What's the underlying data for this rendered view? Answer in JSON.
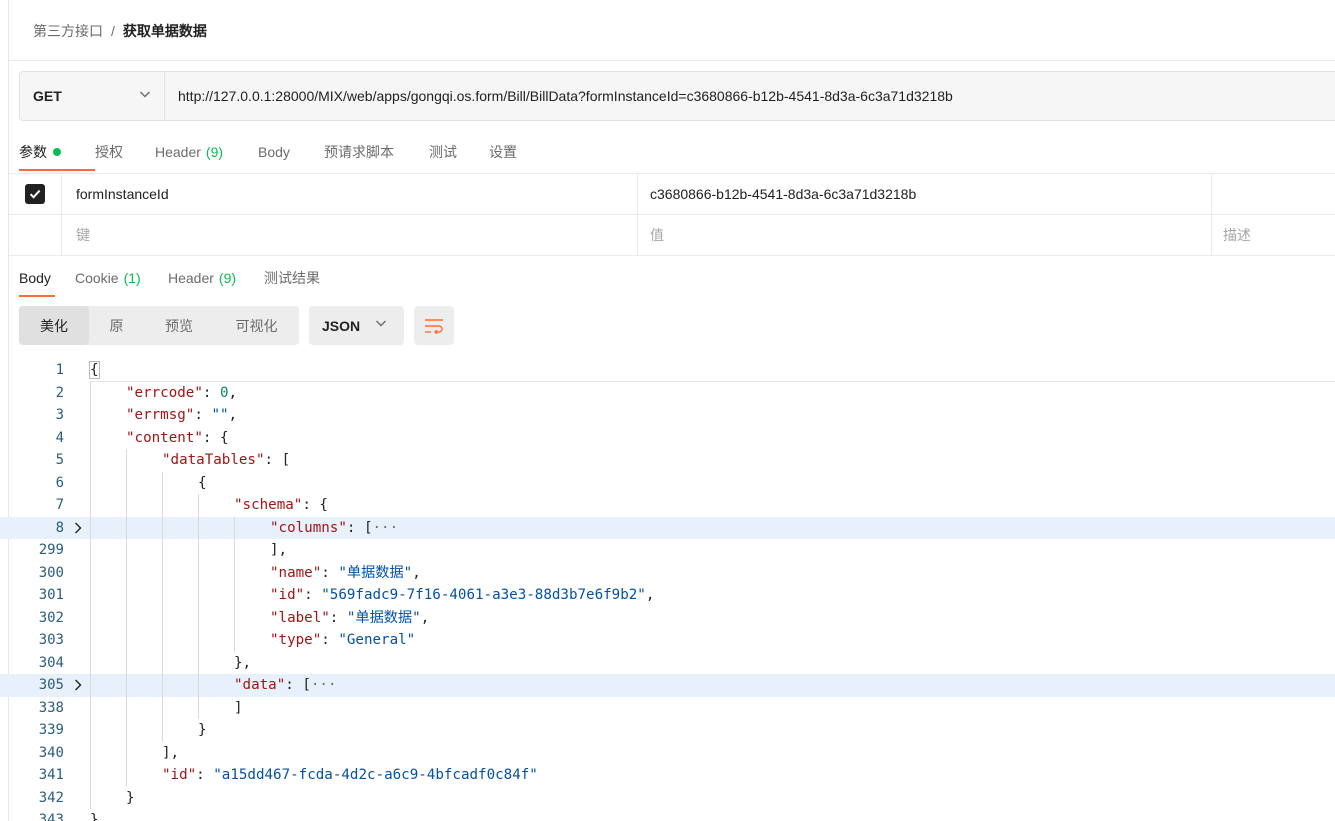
{
  "breadcrumb": {
    "parent": "第三方接口",
    "separator": "/",
    "current": "获取单据数据"
  },
  "request": {
    "method": "GET",
    "url": "http://127.0.0.1:28000/MIX/web/apps/gongqi.os.form/Bill/BillData?formInstanceId=c3680866-b12b-4541-8d3a-6c3a71d3218b"
  },
  "request_tabs": [
    {
      "label": "参数",
      "count": "",
      "dot": true,
      "active": true
    },
    {
      "label": "授权",
      "count": ""
    },
    {
      "label": "Header",
      "count": "(9)"
    },
    {
      "label": "Body",
      "count": ""
    },
    {
      "label": "预请求脚本",
      "count": ""
    },
    {
      "label": "测试",
      "count": ""
    },
    {
      "label": "设置",
      "count": ""
    }
  ],
  "params": {
    "rows": [
      {
        "checked": true,
        "key": "formInstanceId",
        "value": "c3680866-b12b-4541-8d3a-6c3a71d3218b",
        "description": ""
      }
    ],
    "placeholder": {
      "key": "键",
      "value": "值",
      "description": "描述"
    }
  },
  "response_tabs": [
    {
      "label": "Body",
      "count": "",
      "active": true
    },
    {
      "label": "Cookie",
      "count": "(1)"
    },
    {
      "label": "Header",
      "count": "(9)"
    },
    {
      "label": "测试结果",
      "count": ""
    }
  ],
  "view_modes": [
    "美化",
    "原",
    "预览",
    "可视化"
  ],
  "view_mode_active": "美化",
  "format": "JSON",
  "icons": {
    "method_dropdown": "chevron-down-icon",
    "format_dropdown": "chevron-down-icon",
    "wrap": "text-wrap-icon",
    "fold": "chevron-right-icon",
    "checkbox": "checkmark-icon"
  },
  "colors": {
    "accent": "#ff6c37",
    "status_green": "#0cbb52",
    "json_key": "#a31515",
    "json_string": "#0451a5",
    "json_number": "#098658",
    "highlight_row": "#e8f1fb"
  },
  "code_lines": [
    {
      "n": "1",
      "indent": 0,
      "parts": [
        [
          "p",
          "{"
        ]
      ],
      "caret": true
    },
    {
      "n": "2",
      "indent": 1,
      "parts": [
        [
          "k",
          "\"errcode\""
        ],
        [
          "p",
          ": "
        ],
        [
          "n",
          "0"
        ],
        [
          "p",
          ","
        ]
      ]
    },
    {
      "n": "3",
      "indent": 1,
      "parts": [
        [
          "k",
          "\"errmsg\""
        ],
        [
          "p",
          ": "
        ],
        [
          "s",
          "\"\""
        ],
        [
          "p",
          ","
        ]
      ]
    },
    {
      "n": "4",
      "indent": 1,
      "parts": [
        [
          "k",
          "\"content\""
        ],
        [
          "p",
          ": {"
        ]
      ]
    },
    {
      "n": "5",
      "indent": 2,
      "parts": [
        [
          "k",
          "\"dataTables\""
        ],
        [
          "p",
          ": ["
        ]
      ]
    },
    {
      "n": "6",
      "indent": 3,
      "parts": [
        [
          "p",
          "{"
        ]
      ]
    },
    {
      "n": "7",
      "indent": 4,
      "parts": [
        [
          "k",
          "\"schema\""
        ],
        [
          "p",
          ": {"
        ]
      ]
    },
    {
      "n": "8",
      "indent": 5,
      "parts": [
        [
          "k",
          "\"columns\""
        ],
        [
          "p",
          ": ["
        ],
        [
          "ell",
          "···"
        ]
      ],
      "fold": true,
      "hl": true
    },
    {
      "n": "299",
      "indent": 5,
      "parts": [
        [
          "p",
          "],"
        ]
      ]
    },
    {
      "n": "300",
      "indent": 5,
      "parts": [
        [
          "k",
          "\"name\""
        ],
        [
          "p",
          ": "
        ],
        [
          "s",
          "\"单据数据\""
        ],
        [
          "p",
          ","
        ]
      ]
    },
    {
      "n": "301",
      "indent": 5,
      "parts": [
        [
          "k",
          "\"id\""
        ],
        [
          "p",
          ": "
        ],
        [
          "s",
          "\"569fadc9-7f16-4061-a3e3-88d3b7e6f9b2\""
        ],
        [
          "p",
          ","
        ]
      ]
    },
    {
      "n": "302",
      "indent": 5,
      "parts": [
        [
          "k",
          "\"label\""
        ],
        [
          "p",
          ": "
        ],
        [
          "s",
          "\"单据数据\""
        ],
        [
          "p",
          ","
        ]
      ]
    },
    {
      "n": "303",
      "indent": 5,
      "parts": [
        [
          "k",
          "\"type\""
        ],
        [
          "p",
          ": "
        ],
        [
          "s",
          "\"General\""
        ]
      ]
    },
    {
      "n": "304",
      "indent": 4,
      "parts": [
        [
          "p",
          "},"
        ]
      ]
    },
    {
      "n": "305",
      "indent": 4,
      "parts": [
        [
          "k",
          "\"data\""
        ],
        [
          "p",
          ": ["
        ],
        [
          "ell",
          "···"
        ]
      ],
      "fold": true,
      "hl": true
    },
    {
      "n": "338",
      "indent": 4,
      "parts": [
        [
          "p",
          "]"
        ]
      ]
    },
    {
      "n": "339",
      "indent": 3,
      "parts": [
        [
          "p",
          "}"
        ]
      ]
    },
    {
      "n": "340",
      "indent": 2,
      "parts": [
        [
          "p",
          "],"
        ]
      ]
    },
    {
      "n": "341",
      "indent": 2,
      "parts": [
        [
          "k",
          "\"id\""
        ],
        [
          "p",
          ": "
        ],
        [
          "s",
          "\"a15dd467-fcda-4d2c-a6c9-4bfcadf0c84f\""
        ]
      ]
    },
    {
      "n": "342",
      "indent": 1,
      "parts": [
        [
          "p",
          "}"
        ]
      ]
    },
    {
      "n": "343",
      "indent": 0,
      "parts": [
        [
          "p",
          "}"
        ]
      ]
    }
  ]
}
